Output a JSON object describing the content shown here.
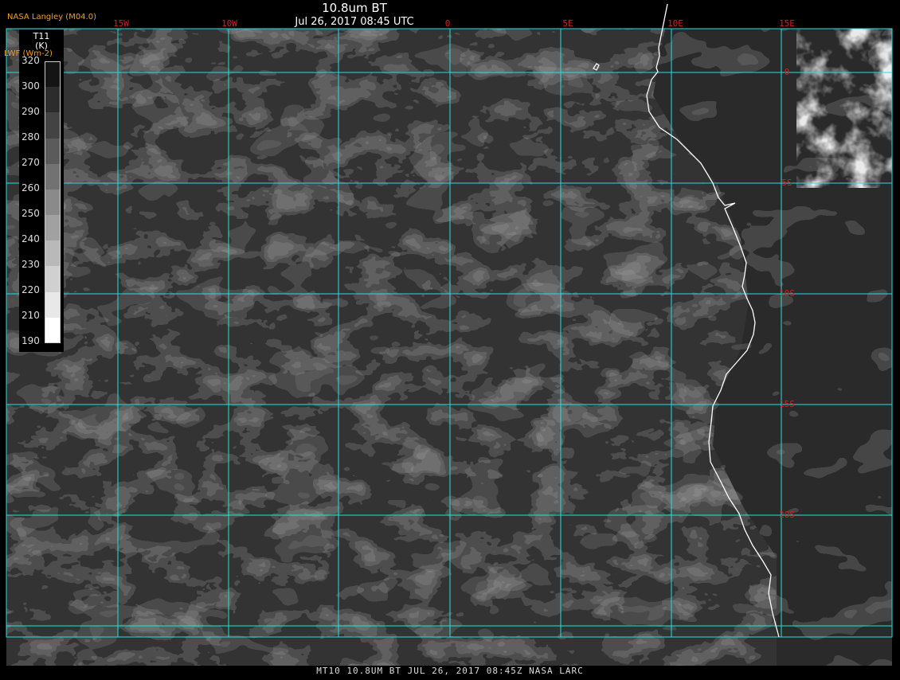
{
  "header": {
    "title": "10.8um BT",
    "subtitle": "Jul 26, 2017 08:45 UTC",
    "credit": "NASA Langley (M04.0)",
    "footer": "MT10  10.8UM BT  JUL 26, 2017 08:45Z  NASA LARC"
  },
  "legend": {
    "title_line1": "T11",
    "title_line2": "(K)",
    "overlay_label": "LWF (Wm-2)",
    "ticks": [
      "320",
      "300",
      "290",
      "280",
      "270",
      "260",
      "250",
      "240",
      "230",
      "220",
      "210",
      "190"
    ]
  },
  "map": {
    "lon_labels": [
      "15W",
      "10W",
      "0",
      "5E",
      "10E",
      "15E"
    ],
    "lat_labels": [
      "0",
      "5S",
      "10S",
      "15S",
      "20S"
    ],
    "colors": {
      "grid": "#22e0e0",
      "coast": "#ffffff",
      "lon_label": "#d02020",
      "credit": "#f0a020"
    }
  }
}
